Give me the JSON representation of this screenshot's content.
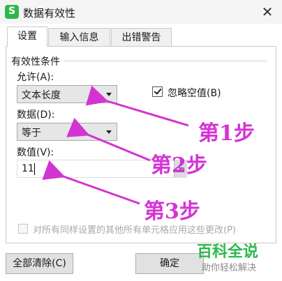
{
  "window": {
    "app_icon_letter": "S",
    "title": "数据有效性",
    "close_glyph": "✕"
  },
  "tabs": [
    {
      "label": "设置",
      "active": true
    },
    {
      "label": "输入信息",
      "active": false
    },
    {
      "label": "出错警告",
      "active": false
    }
  ],
  "settings": {
    "section_title": "有效性条件",
    "allow_label": "允许(A):",
    "allow_value": "文本长度",
    "ignore_blank_label": "忽略空值(B)",
    "ignore_blank_checked": true,
    "data_label": "数据(D):",
    "data_value": "等于",
    "value_label": "数值(V):",
    "value_input": "11",
    "apply_all_label": "对所有同样设置的其他所有单元格应用这些更改(P)",
    "apply_all_checked": false
  },
  "buttons": {
    "clear_all": "全部清除(C)",
    "ok": "确定"
  },
  "annotations": {
    "step1": "第1步",
    "step2": "第2步",
    "step3": "第3步",
    "color": "#d433d4"
  },
  "watermark": {
    "title": "百科全说",
    "subtitle": "助你轻松解决"
  }
}
